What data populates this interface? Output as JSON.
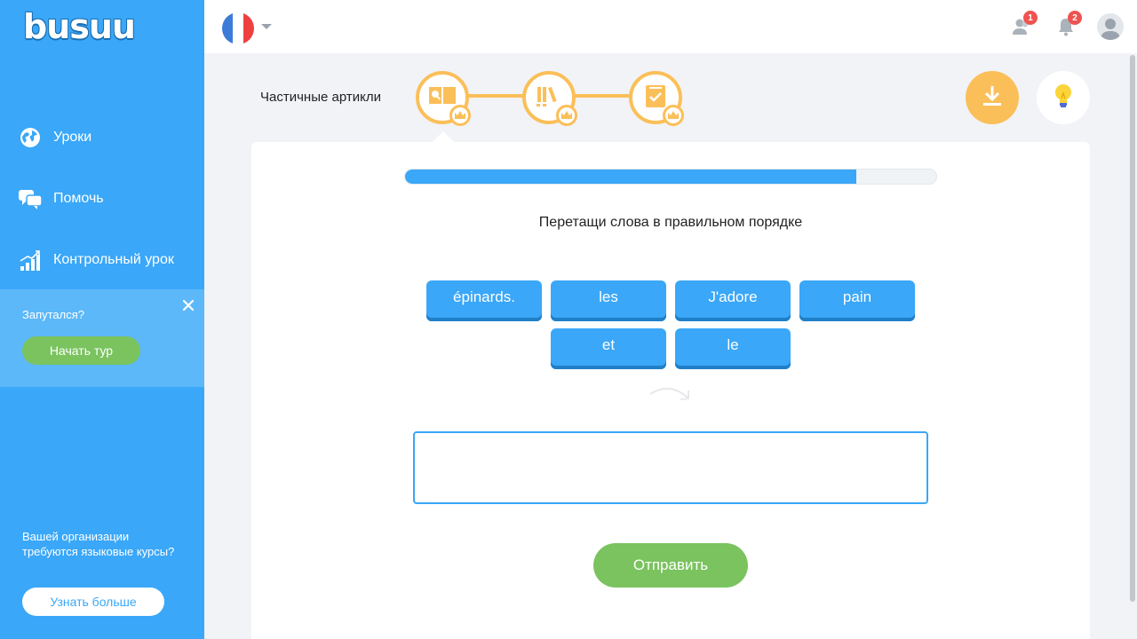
{
  "app": {
    "logo": "busuu"
  },
  "sidebar": {
    "items": [
      {
        "label": "Уроки",
        "icon": "globe-icon"
      },
      {
        "label": "Помочь",
        "icon": "chat-bubbles-icon"
      },
      {
        "label": "Контрольный урок",
        "icon": "bar-chart-icon"
      }
    ],
    "tour": {
      "question": "Запутался?",
      "button": "Начать тур"
    },
    "org": {
      "text": "Вашей организации требуются языковые курсы?",
      "button": "Узнать больше"
    }
  },
  "topbar": {
    "language_flag": "french-flag",
    "friends_badge": "1",
    "notifications_badge": "2"
  },
  "lesson": {
    "title": "Частичные артикли",
    "steps": [
      {
        "icon": "book-search-icon"
      },
      {
        "icon": "books-icon"
      },
      {
        "icon": "checklist-book-icon"
      }
    ]
  },
  "exercise": {
    "progress_fraction": 0.85,
    "instruction": "Перетащи слова в правильном порядке",
    "words": [
      "épinards.",
      "les",
      "J'adore",
      "pain",
      "et",
      "le"
    ],
    "answer": "",
    "submit_label": "Отправить"
  },
  "colors": {
    "sidebar": "#3aa7f8",
    "accent_orange": "#fbbf59",
    "green": "#7ac35f",
    "badge_red": "#ef5350"
  }
}
